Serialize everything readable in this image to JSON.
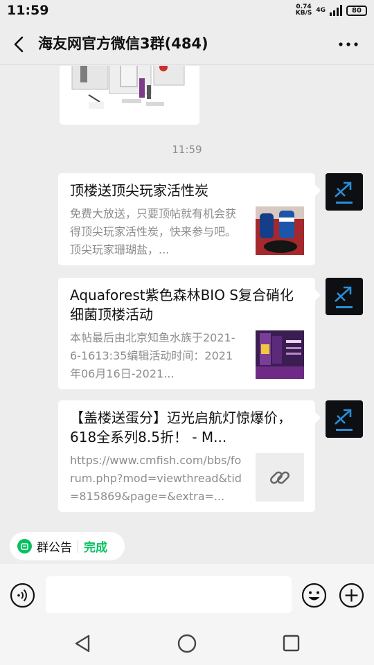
{
  "status_bar": {
    "time": "11:59",
    "net_speed_value": "0.74",
    "net_speed_unit": "KB/S",
    "network_type": "4G",
    "battery": "80"
  },
  "header": {
    "title": "海友网官方微信3群(484)"
  },
  "messages": {
    "timestamp": "11:59",
    "cards": [
      {
        "title": "顶楼送顶尖玩家活性炭",
        "description": "免费大放送，只要顶帖就有机会获得顶尖玩家活性炭，快来参与吧。顶尖玩家珊瑚盐，...",
        "thumb": "product-photo"
      },
      {
        "title": "Aquaforest紫色森林BIO S复合硝化细菌顶楼活动",
        "description": "本帖最后由北京知鱼水族于2021-6-1613:35编辑活动时间：2021年06月16日-2021...",
        "thumb": "product-photo"
      },
      {
        "title": "【盖楼送蛋分】迈光启航灯惊爆价，618全系列8.5折！ - M...",
        "description": "https://www.cmfish.com/bbs/forum.php?mod=viewthread&tid=815869&page=&extra=...",
        "thumb": "link-icon"
      }
    ]
  },
  "announcement": {
    "label": "群公告",
    "done_label": "完成"
  },
  "input_bar": {
    "voice_icon": "voice-icon",
    "emoji_icon": "emoji-icon",
    "plus_icon": "plus-icon"
  },
  "colors": {
    "accent_green": "#07c160",
    "background": "#ededed",
    "card": "#ffffff",
    "muted_text": "#8c8c8c"
  }
}
